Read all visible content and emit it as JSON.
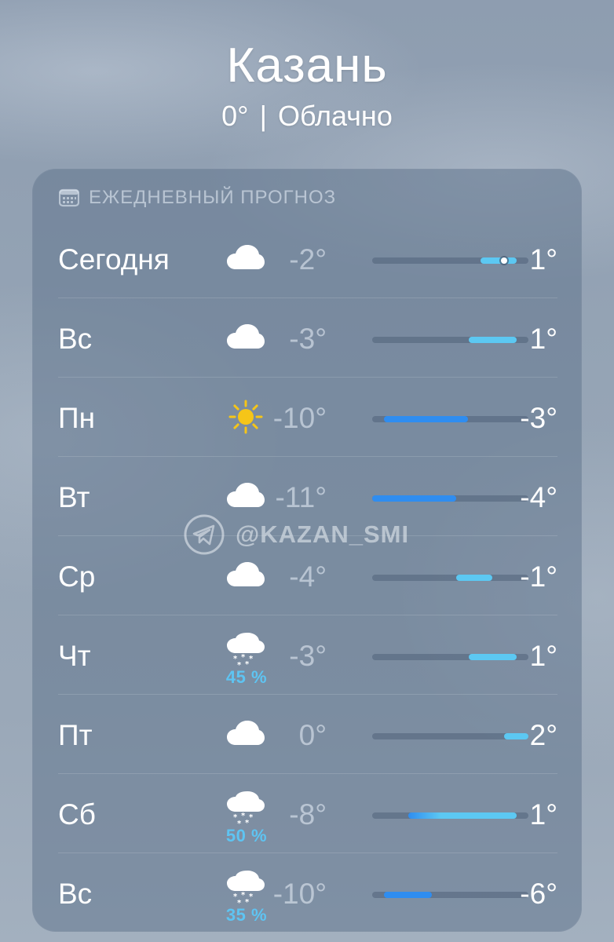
{
  "header": {
    "city": "Казань",
    "current_temp": "0°",
    "separator": "|",
    "condition": "Облачно"
  },
  "forecast": {
    "title": "ЕЖЕДНЕВНЫЙ ПРОГНОЗ",
    "title_icon": "calendar-icon",
    "range_min": -11,
    "range_max": 2,
    "days": [
      {
        "day": "Сегодня",
        "icon": "cloud-icon",
        "precip": "",
        "low": "-2°",
        "high": "1°",
        "low_val": -2,
        "high_val": 1,
        "current_val": 0
      },
      {
        "day": "Вс",
        "icon": "cloud-icon",
        "precip": "",
        "low": "-3°",
        "high": "1°",
        "low_val": -3,
        "high_val": 1
      },
      {
        "day": "Пн",
        "icon": "sun-icon",
        "precip": "",
        "low": "-10°",
        "high": "-3°",
        "low_val": -10,
        "high_val": -3
      },
      {
        "day": "Вт",
        "icon": "cloud-icon",
        "precip": "",
        "low": "-11°",
        "high": "-4°",
        "low_val": -11,
        "high_val": -4
      },
      {
        "day": "Ср",
        "icon": "cloud-icon",
        "precip": "",
        "low": "-4°",
        "high": "-1°",
        "low_val": -4,
        "high_val": -1
      },
      {
        "day": "Чт",
        "icon": "snow-cloud-icon",
        "precip": "45 %",
        "low": "-3°",
        "high": "1°",
        "low_val": -3,
        "high_val": 1
      },
      {
        "day": "Пт",
        "icon": "cloud-icon",
        "precip": "",
        "low": "0°",
        "high": "2°",
        "low_val": 0,
        "high_val": 2
      },
      {
        "day": "Сб",
        "icon": "snow-cloud-icon",
        "precip": "50 %",
        "low": "-8°",
        "high": "1°",
        "low_val": -8,
        "high_val": 1
      },
      {
        "day": "Вс",
        "icon": "snow-cloud-icon",
        "precip": "35 %",
        "low": "-10°",
        "high": "-6°",
        "low_val": -10,
        "high_val": -6
      }
    ]
  },
  "watermark": {
    "text": "@KAZAN_SMI",
    "icon": "telegram-icon"
  },
  "colors": {
    "bar_cold": "#2f8df0",
    "bar_cool": "#5cc8f2",
    "precip": "#5ec4f2",
    "sun": "#f5c518"
  }
}
